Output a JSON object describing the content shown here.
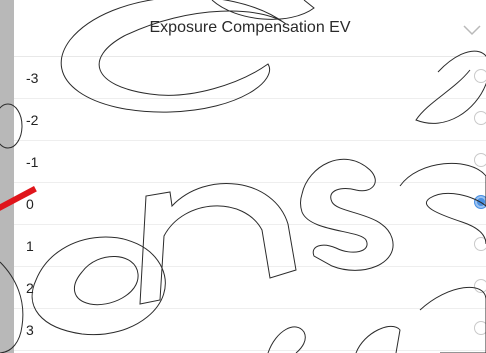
{
  "sheet": {
    "title": "Exposure Compensation EV",
    "collapse_icon": "chevron-down-icon"
  },
  "options": [
    {
      "label": "-3",
      "selected": false
    },
    {
      "label": "-2",
      "selected": false
    },
    {
      "label": "-1",
      "selected": false
    },
    {
      "label": "0",
      "selected": true
    },
    {
      "label": "1",
      "selected": false
    },
    {
      "label": "2",
      "selected": false
    },
    {
      "label": "3",
      "selected": false
    }
  ],
  "colors": {
    "accent": "#4a90e2",
    "overlay_stroke": "#e0151b"
  }
}
